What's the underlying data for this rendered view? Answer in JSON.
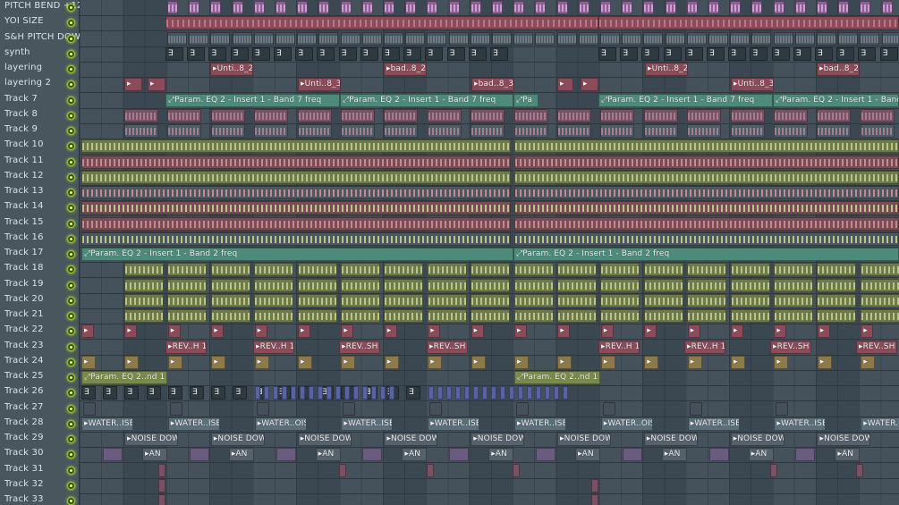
{
  "tracks": [
    {
      "name": "PITCH BEND +12"
    },
    {
      "name": "YOI SIZE"
    },
    {
      "name": "S&H PITCH DOWN"
    },
    {
      "name": "synth"
    },
    {
      "name": "layering"
    },
    {
      "name": "layering 2"
    },
    {
      "name": "Track 7"
    },
    {
      "name": "Track 8"
    },
    {
      "name": "Track 9"
    },
    {
      "name": "Track 10"
    },
    {
      "name": "Track 11"
    },
    {
      "name": "Track 12"
    },
    {
      "name": "Track 13"
    },
    {
      "name": "Track 14"
    },
    {
      "name": "Track 15"
    },
    {
      "name": "Track 16"
    },
    {
      "name": "Track 17"
    },
    {
      "name": "Track 18"
    },
    {
      "name": "Track 19"
    },
    {
      "name": "Track 20"
    },
    {
      "name": "Track 21"
    },
    {
      "name": "Track 22"
    },
    {
      "name": "Track 23"
    },
    {
      "name": "Track 24"
    },
    {
      "name": "Track 25"
    },
    {
      "name": "Track 26"
    },
    {
      "name": "Track 27"
    },
    {
      "name": "Track 28"
    },
    {
      "name": "Track 29"
    },
    {
      "name": "Track 30"
    },
    {
      "name": "Track 31"
    },
    {
      "name": "Track 32"
    },
    {
      "name": "Track 33"
    }
  ],
  "clips": {
    "layering": [
      "▸Unti..8_2",
      "▸bad..8_2",
      "▸Unti..8_2",
      "▸bad..8_2"
    ],
    "layering2": [
      "▸Unti..8_3",
      "▸bad..8_3",
      "▸Unti..8_3"
    ],
    "track7": [
      "⤢Param. EQ 2 - Insert 1 - Band 7 freq",
      "⤢Param. EQ 2 - Insert 1 - Band 7 freq",
      "⤢Pa",
      "⤢Param. EQ 2 - Insert 1 - Band 7 freq",
      "⤢Param. EQ 2 - Insert 1 - Band"
    ],
    "track17": [
      "⤢Param. EQ 2 - Insert 1 - Band 2 freq",
      "⤢Param. EQ 2 - Insert 1 - Band 2 freq"
    ],
    "track23": [
      "▸REV..H 1",
      "▸REV..H 1",
      "▸REV..SH 1",
      "▸REV..SH 1",
      "▸REV..H 1",
      "▸REV..H 1",
      "▸REV..SH 1",
      "▸REV..SH 1"
    ],
    "track25": [
      "⤢Param. EQ 2..nd 1 freq",
      "⤢Param. EQ 2..nd 1 freq"
    ],
    "track28": [
      "▸WATER..ISE",
      "▸WATER..ISE",
      "▸WATER..OISE",
      "▸WATER..ISE",
      "▸WATER..ISE",
      "▸WATER..ISE",
      "▸WATER..OISE",
      "▸WATER..ISE",
      "▸WATER..ISE",
      "▸WATER.."
    ],
    "track29": [
      "▸NOISE DOWN",
      "▸NOISE DOWN",
      "▸NOISE DOWN",
      "▸NOISE DOWN",
      "▸NOISE DOWN",
      "▸NOISE DOWN",
      "▸NOISE DOWN",
      "▸NOISE DOWN",
      "▸NOISE DOWN"
    ],
    "track30": [
      "▸AN",
      "▸AN",
      "▸AN",
      "▸AN",
      "▸AN",
      "▸AN",
      "▸AN",
      "▸AN",
      "▸AN"
    ],
    "synth_marker": "∃",
    "arrow": "▸"
  },
  "colors": {
    "purple": "#8e5f93",
    "red": "#8a4c59",
    "teal": "#4d8a7a",
    "olive": "#6f7a4b",
    "tan": "#8c7a4a",
    "blue": "#5963a3",
    "green_led": "#9ccc1f"
  }
}
